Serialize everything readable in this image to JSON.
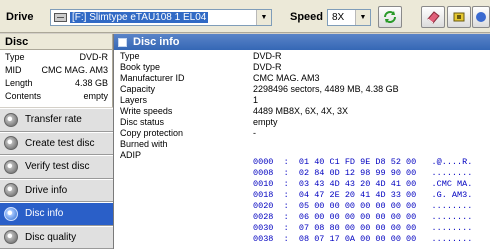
{
  "toolbar": {
    "drive_label": "Drive",
    "drive_value": "[F:]  Slimtype eTAU108   1 EL04",
    "speed_label": "Speed",
    "speed_value": "8X"
  },
  "disc": {
    "title": "Disc",
    "rows": [
      {
        "key": "Type",
        "value": "DVD-R"
      },
      {
        "key": "MID",
        "value": "CMC MAG. AM3"
      },
      {
        "key": "Length",
        "value": "4.38 GB"
      },
      {
        "key": "Contents",
        "value": "empty"
      }
    ]
  },
  "nav": [
    {
      "label": "Transfer rate",
      "active": false
    },
    {
      "label": "Create test disc",
      "active": false
    },
    {
      "label": "Verify test disc",
      "active": false
    },
    {
      "label": "Drive info",
      "active": false
    },
    {
      "label": "Disc info",
      "active": true
    },
    {
      "label": "Disc quality",
      "active": false
    }
  ],
  "info": {
    "title": "Disc info",
    "rows": [
      {
        "key": "Type",
        "value": "DVD-R"
      },
      {
        "key": "Book type",
        "value": "DVD-R"
      },
      {
        "key": "Manufacturer ID",
        "value": "CMC MAG. AM3"
      },
      {
        "key": "Capacity",
        "value": "2298496 sectors, 4489 MB, 4.38 GB"
      },
      {
        "key": "Layers",
        "value": "1"
      },
      {
        "key": "Write speeds",
        "value": "4489 MB8X, 6X, 4X, 3X"
      },
      {
        "key": "Disc status",
        "value": "empty"
      },
      {
        "key": "Copy protection",
        "value": "-"
      },
      {
        "key": "Burned with",
        "value": ""
      },
      {
        "key": "ADIP",
        "value": ""
      }
    ],
    "adip_hex": [
      "0000  :  01 40 C1 FD 9E D8 52 00   .@....R.",
      "0008  :  02 84 0D 12 98 99 90 00   ........",
      "0010  :  03 43 4D 43 20 4D 41 00   .CMC MA.",
      "0018  :  04 47 2E 20 41 4D 33 00   .G. AM3.",
      "0020  :  05 00 00 00 00 00 00 00   ........",
      "0028  :  06 00 00 00 00 00 00 00   ........",
      "0030  :  07 08 80 00 00 00 00 00   ........",
      "0038  :  08 07 17 0A 00 00 00 00   ........"
    ]
  }
}
